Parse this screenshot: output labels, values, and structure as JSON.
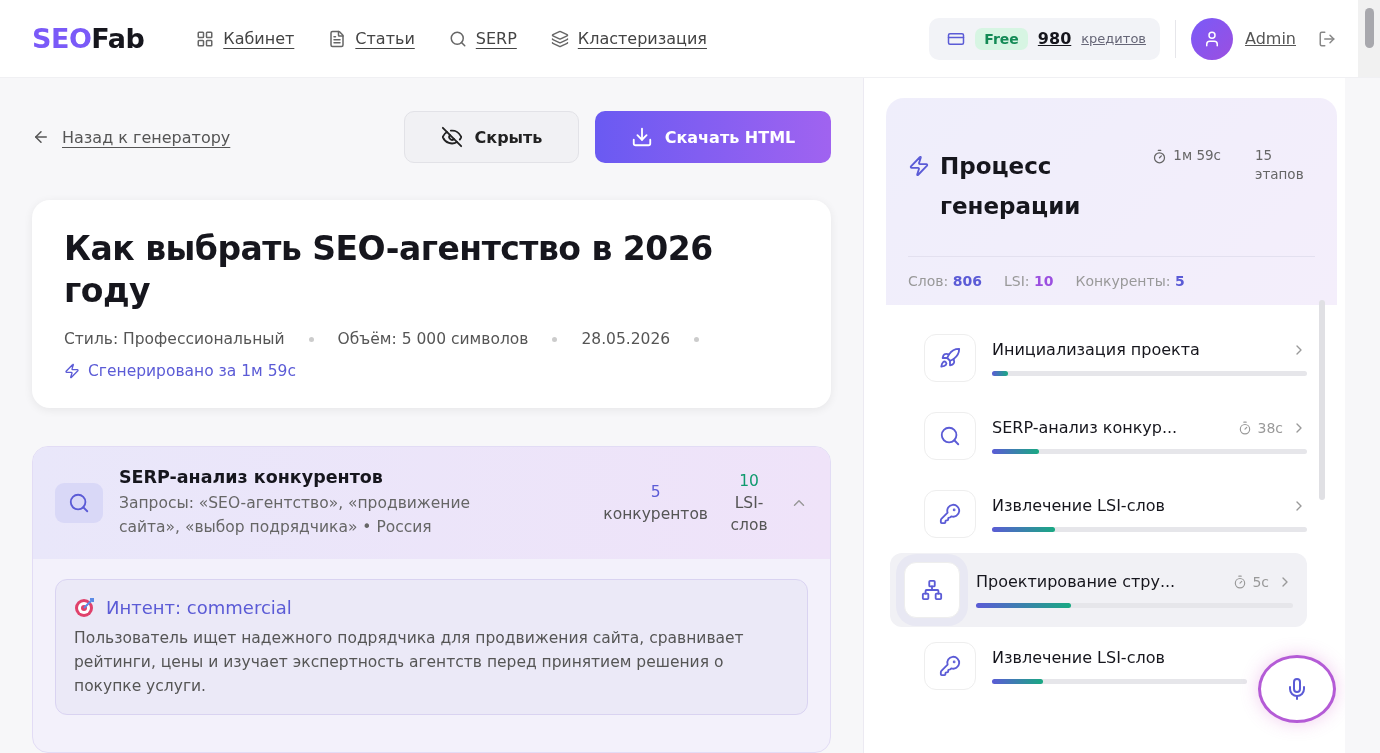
{
  "header": {
    "logo": {
      "part_1": "SEO",
      "part_2": "Fab"
    },
    "nav": [
      {
        "label": "Кабинет"
      },
      {
        "label": "Статьи"
      },
      {
        "label": "SERP"
      },
      {
        "label": "Кластеризация"
      }
    ],
    "credits": {
      "plan": "Free",
      "amount": "980",
      "unit": "кредитов"
    },
    "user": {
      "name": "Admin"
    }
  },
  "toolbar": {
    "back_link": "Назад к генератору",
    "hide_button": "Скрыть",
    "download_button": "Скачать HTML"
  },
  "article": {
    "title": "Как выбрать SEO-агентство в 2026 году",
    "meta": [
      "Стиль: Профессиональный",
      "Объём: 5 000 символов",
      "28.05.2026"
    ],
    "generated": "Сгенерировано за 1м 59с"
  },
  "serp": {
    "title": "SERP-анализ конкурентов",
    "queries": "Запросы: «SEO-агентство», «продвижение сайта», «выбор подрядчика» • Россия",
    "expanded": true,
    "stats": [
      {
        "value": "5",
        "label": "конкурентов",
        "color": "#5b5bd6"
      },
      {
        "value": "10",
        "label": "LSI-слов",
        "color": "#0f9a6e"
      }
    ],
    "intent": {
      "title": "Интент: commercial",
      "text": "Пользователь ищет надежного подрядчика для продвижения сайта, сравнивает рейтинги, цены и изучает экспертность агентств перед принятием решения о покупке услуги."
    }
  },
  "process": {
    "title": "Процесс генерации",
    "time": "1м 59с",
    "stages": "15 этапов",
    "stats": [
      {
        "label": "Слов:",
        "value": "806",
        "color": "#5b5bd6"
      },
      {
        "label": "LSI:",
        "value": "10",
        "color": "#9b4fe0"
      },
      {
        "label": "Конкуренты:",
        "value": "5",
        "color": "#5b5bd6"
      }
    ],
    "steps": [
      {
        "kind": "rocket",
        "title": "Инициализация проекта",
        "level": 0.05,
        "selected": false
      },
      {
        "kind": "search",
        "title": "SERP-анализ конкур...",
        "time": "38с",
        "level": 0.15,
        "selected": false
      },
      {
        "kind": "key",
        "title": "Извлечение LSI-слов",
        "level": 0.2,
        "selected": false
      },
      {
        "kind": "sitemap",
        "title": "Проектирование стру...",
        "time": "5с",
        "level": 0.3,
        "selected": true
      },
      {
        "kind": "key",
        "title": "Извлечение LSI-слов",
        "level": 0.2,
        "selected": false
      }
    ]
  }
}
